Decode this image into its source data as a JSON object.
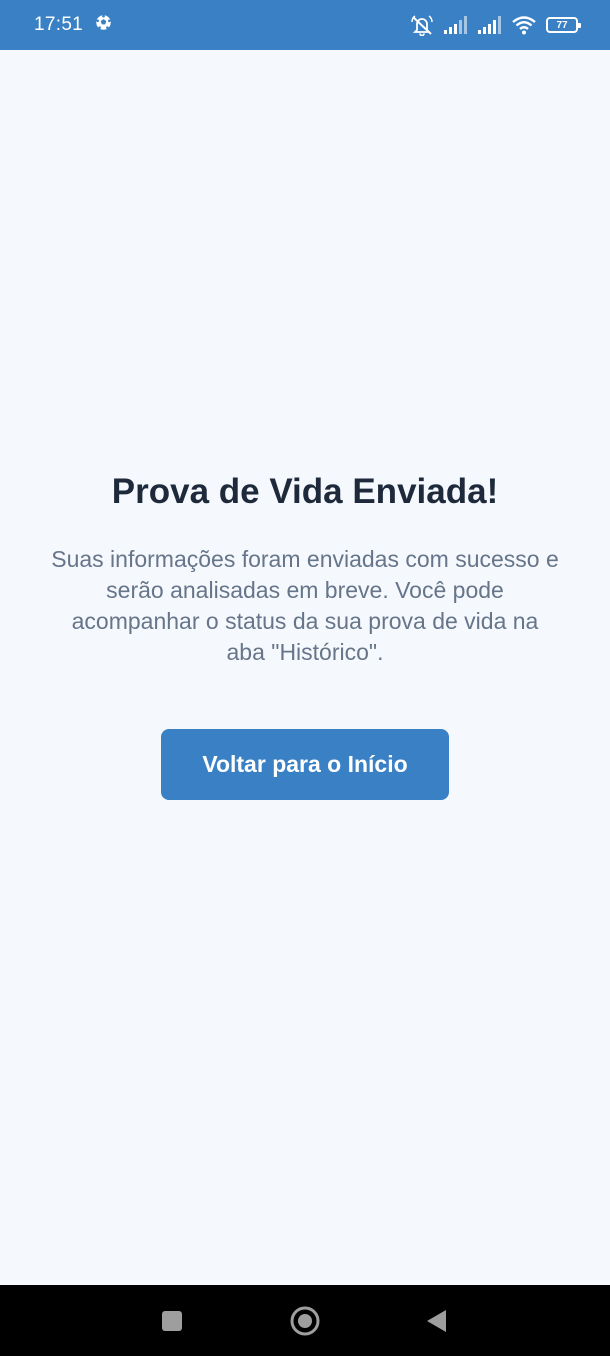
{
  "status_bar": {
    "time": "17:51",
    "battery_level": "77",
    "icons": [
      "soccer-ball-icon",
      "alarm-off-icon",
      "signal-icon",
      "signal-icon",
      "wifi-icon",
      "battery-icon"
    ]
  },
  "main": {
    "title": "Prova de Vida Enviada!",
    "message": "Suas informações foram enviadas com sucesso e serão analisadas em breve. Você pode acompanhar o status da sua prova de vida na aba \"Histórico\".",
    "button_label": "Voltar para o Início"
  },
  "nav_bar": {
    "buttons": [
      "recents-square-icon",
      "home-circle-icon",
      "back-triangle-icon"
    ]
  },
  "colors": {
    "accent": "#3a80c4",
    "background": "#f5f8fc",
    "title": "#1e2a3b",
    "body_text": "#66758a"
  }
}
